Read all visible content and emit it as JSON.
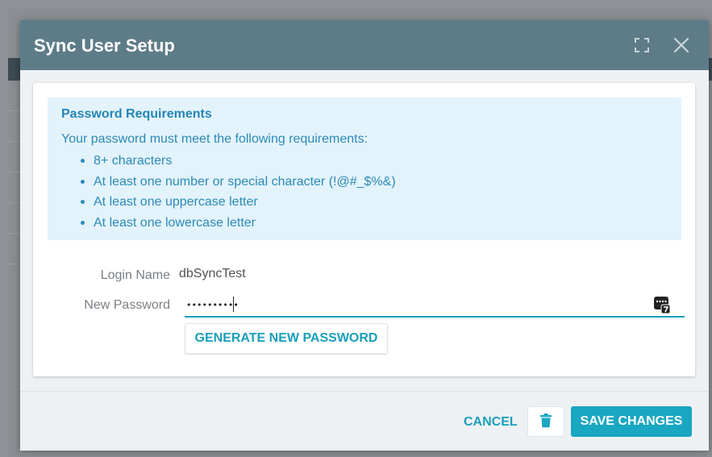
{
  "modal": {
    "title": "Sync User Setup"
  },
  "requirements": {
    "title": "Password Requirements",
    "intro": "Your password must meet the following requirements:",
    "items": [
      "8+ characters",
      "At least one number or special character (!@#_$%&)",
      "At least one uppercase letter",
      "At least one lowercase letter"
    ]
  },
  "form": {
    "login_label": "Login Name",
    "login_value": "dbSyncTest",
    "password_label": "New Password",
    "password_value": "••••••••••",
    "generate_label": "GENERATE NEW PASSWORD"
  },
  "footer": {
    "cancel_label": "CANCEL",
    "save_label": "SAVE CHANGES"
  },
  "icons": {
    "expand": "expand-icon",
    "close": "close-icon",
    "password_manager": "password-manager-icon",
    "delete": "trash-icon"
  },
  "colors": {
    "header": "#5e7c88",
    "accent": "#1aa7c2",
    "info_bg": "#e3f3fb",
    "info_text": "#2b8ab8"
  }
}
